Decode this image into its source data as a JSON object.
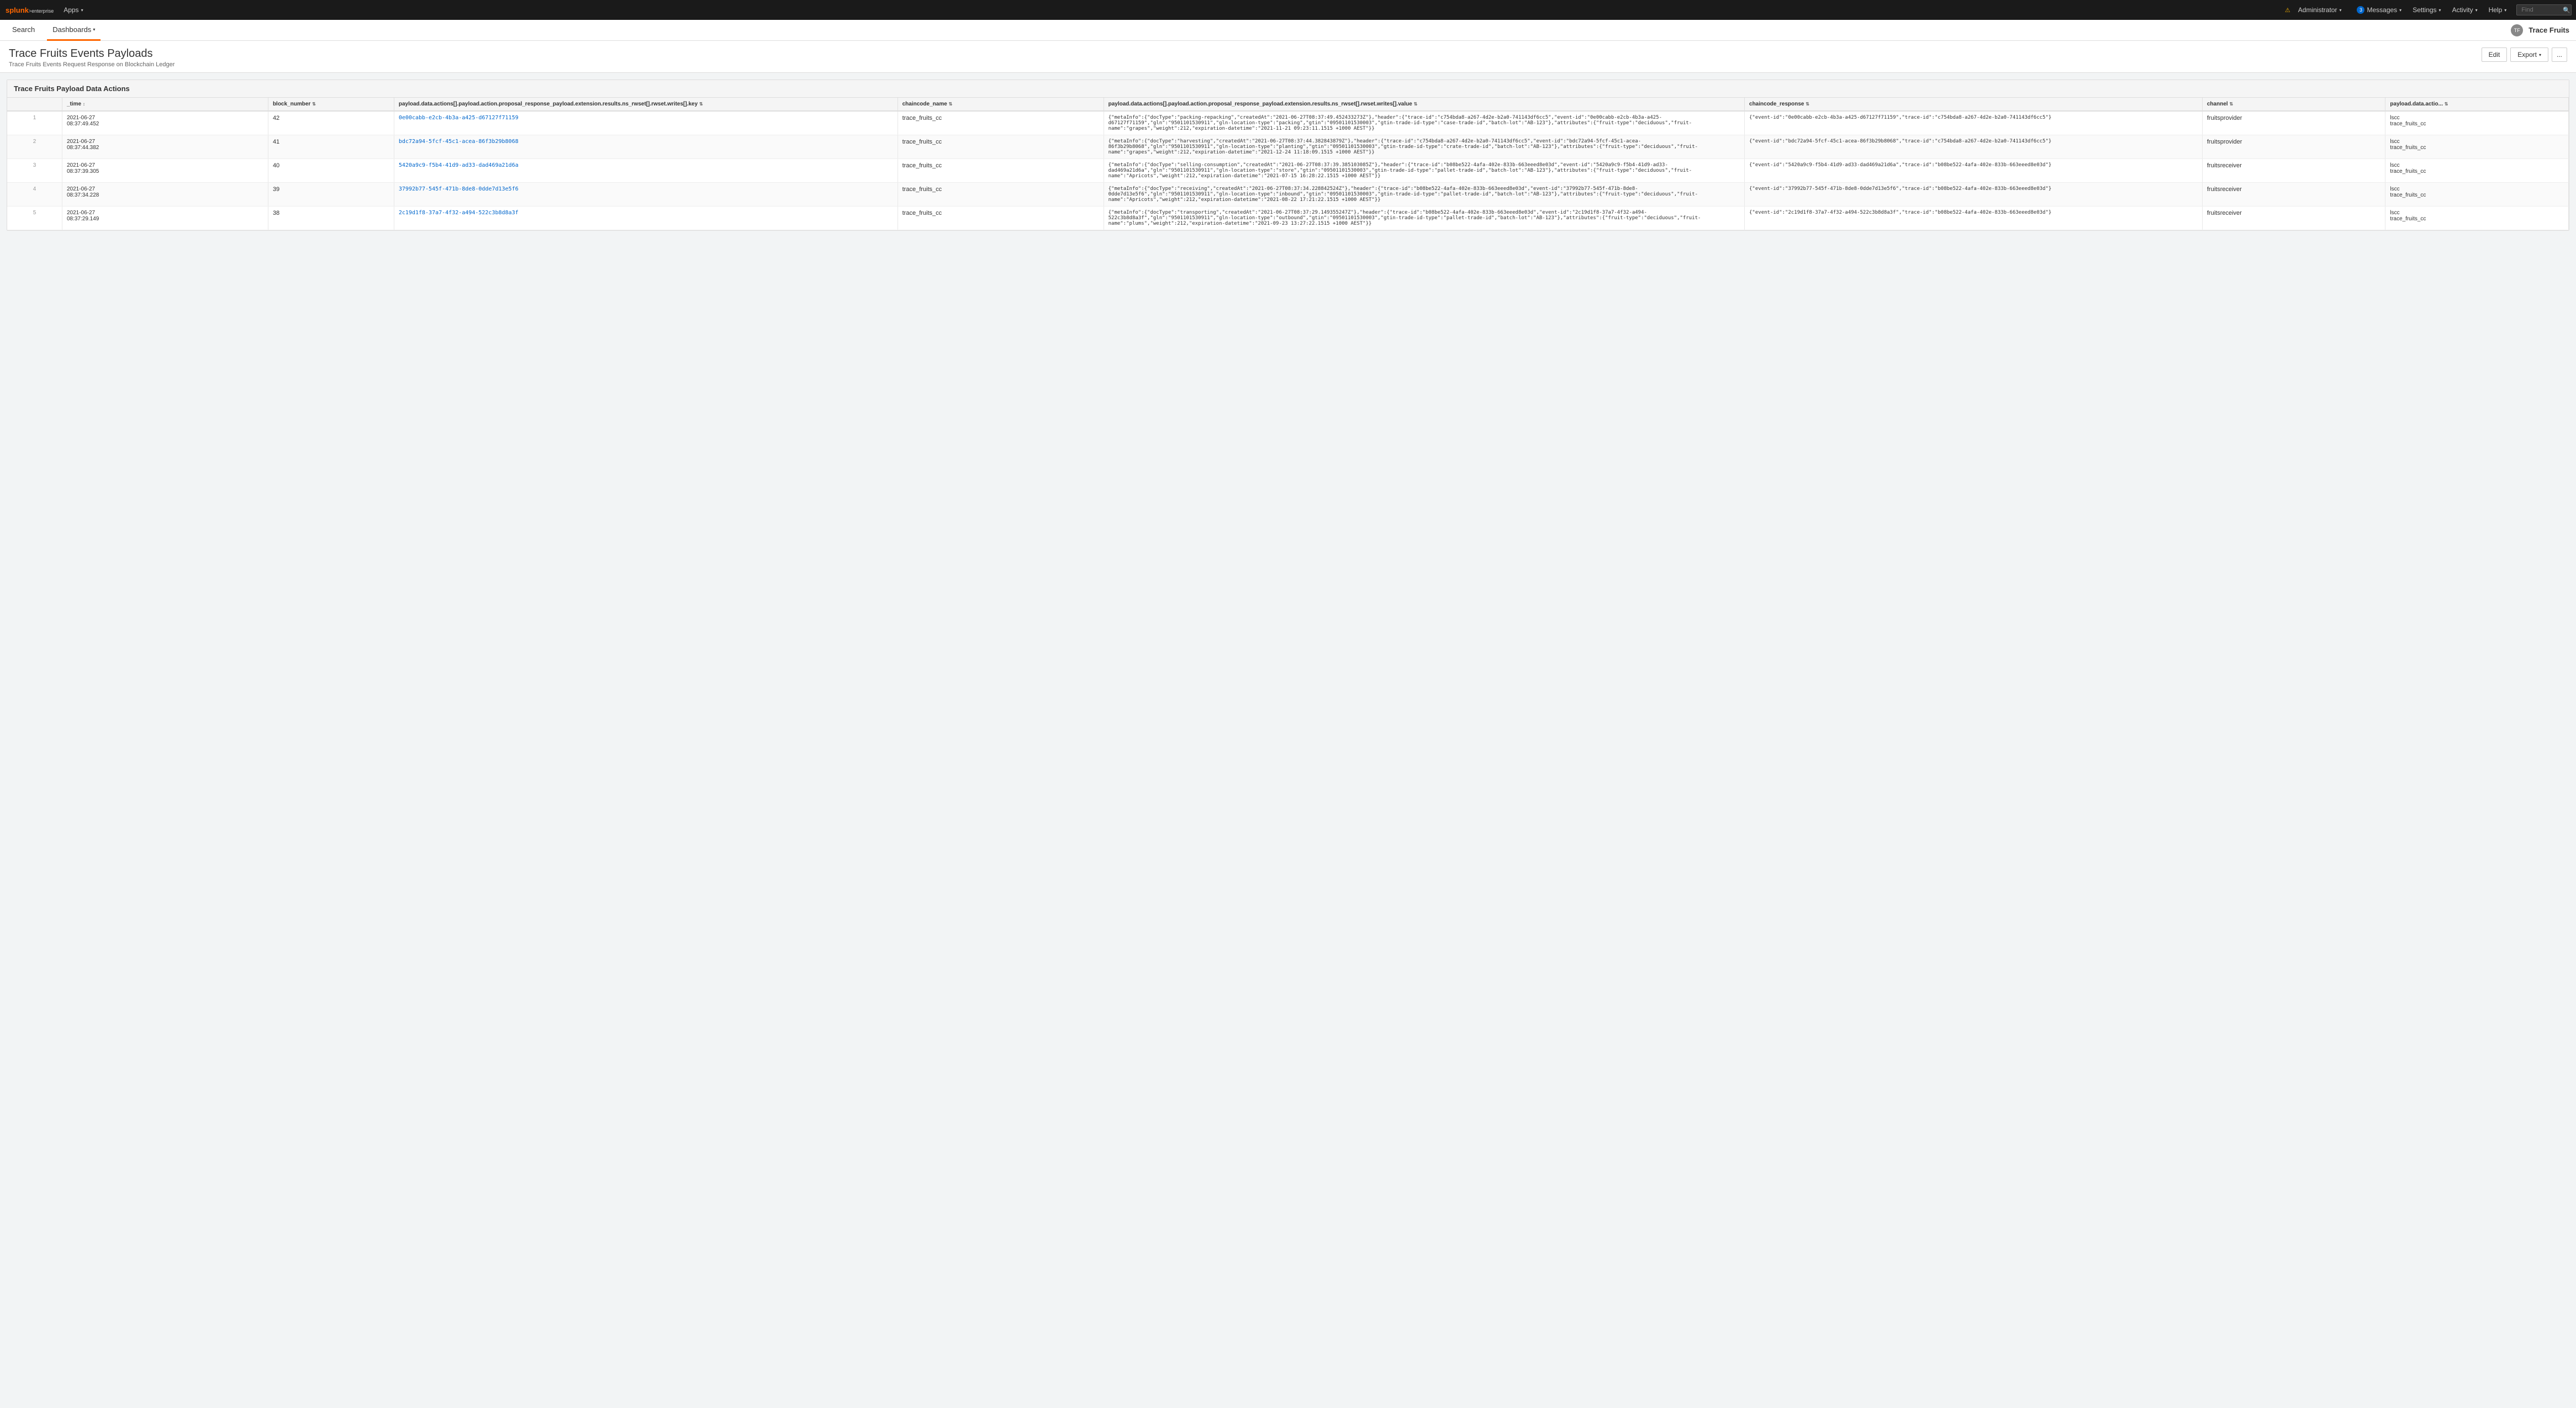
{
  "topNav": {
    "logo": "splunk>enterprise",
    "apps_label": "Apps",
    "activity_label": "Activity",
    "messages_label": "Messages",
    "messages_count": "3",
    "settings_label": "Settings",
    "help_label": "Help",
    "find_placeholder": "Find",
    "admin_label": "Administrator"
  },
  "secondNav": {
    "search_label": "Search",
    "dashboards_label": "Dashboards",
    "app_label": "Trace Fruits"
  },
  "page": {
    "title": "Trace Fruits Events Payloads",
    "subtitle": "Trace Fruits Events Request Response on Blockchain Ledger",
    "edit_label": "Edit",
    "export_label": "Export",
    "more_label": "..."
  },
  "table": {
    "title": "Trace Fruits Payload Data Actions",
    "columns": [
      "",
      "_time ↕",
      "block_number ⇅",
      "payload.data.actions[].payload.action.proposal_response_payload.extension.results.ns_rwset[].rwset.writes[].key ⇅",
      "chaincode_name ⇅",
      "payload.data.actions[].payload.action.proposal_response_payload.extension.results.ns_rwset[].rwset.writes[].value ⇅",
      "chaincode_response ⇅",
      "channel ⇅",
      "payload.data.actio... ⇅"
    ],
    "rows": [
      {
        "num": "1",
        "time": "2021-06-27\n08:37:49.452",
        "block_number": "42",
        "key": "0e00cabb-e2cb-4b3a-a425-d67127f71159",
        "chaincode_name": "trace_fruits_cc",
        "value": "{\"metaInfo\":{\"docType\":\"packing-repacking\",\"createdAt\":\"2021-06-27T08:37:49.452433273Z\"},\"header\":{\"trace-id\":\"c754bda8-a267-4d2e-b2a0-741143df6cc5\",\"event-id\":\"0e00cabb-e2cb-4b3a-a425-d67127f71159\",\"gln\":\"9501101530911\",\"gln-location-type\":\"packing\",\"gtin\":\"09501101530003\",\"gtin-trade-id-type\":\"case-trade-id\",\"batch-lot\":\"AB-123\"},\"attributes\":{\"fruit-type\":\"deciduous\",\"fruit-name\":\"grapes\",\"weight\":212,\"expiration-datetime\":\"2021-11-21 09:23:11.1515 +1000 AEST\"}}",
        "chaincode_response": "{\"event-id\":\"0e00cabb-e2cb-4b3a-a425-d67127f71159\",\"trace-id\":\"c754bda8-a267-4d2e-b2a0-741143df6cc5\"}",
        "channel": "fruitsprovider",
        "payload_action": "lscc\ntrace_fruits_cc"
      },
      {
        "num": "2",
        "time": "2021-06-27\n08:37:44.382",
        "block_number": "41",
        "key": "bdc72a94-5fcf-45c1-acea-86f3b29b8068",
        "chaincode_name": "trace_fruits_cc",
        "value": "{\"metaInfo\":{\"docType\":\"harvesting\",\"createdAt\":\"2021-06-27T08:37:44.382843879Z\"},\"header\":{\"trace-id\":\"c754bda8-a267-4d2e-b2a0-741143df6cc5\",\"event-id\":\"bdc72a94-5fcf-45c1-acea-86f3b29b8068\",\"gln\":\"9501101530911\",\"gln-location-type\":\"planting\",\"gtin\":\"09501101530003\",\"gtin-trade-id-type\":\"crate-trade-id\",\"batch-lot\":\"AB-123\"},\"attributes\":{\"fruit-type\":\"deciduous\",\"fruit-name\":\"grapes\",\"weight\":212,\"expiration-datetime\":\"2021-12-24 11:18:09.1515 +1000 AEST\"}}",
        "chaincode_response": "{\"event-id\":\"bdc72a94-5fcf-45c1-acea-86f3b29b8068\",\"trace-id\":\"c754bda8-a267-4d2e-b2a0-741143df6cc5\"}",
        "channel": "fruitsprovider",
        "payload_action": "lscc\ntrace_fruits_cc"
      },
      {
        "num": "3",
        "time": "2021-06-27\n08:37:39.305",
        "block_number": "40",
        "key": "5420a9c9-f5b4-41d9-ad33-dad469a21d6a",
        "chaincode_name": "trace_fruits_cc",
        "value": "{\"metaInfo\":{\"docType\":\"selling-consumption\",\"createdAt\":\"2021-06-27T08:37:39.385103085Z\"},\"header\":{\"trace-id\":\"b08be522-4afa-402e-833b-663eeed8e03d\",\"event-id\":\"5420a9c9-f5b4-41d9-ad33-dad469a21d6a\",\"gln\":\"9501101530911\",\"gln-location-type\":\"store\",\"gtin\":\"09501101530003\",\"gtin-trade-id-type\":\"pallet-trade-id\",\"batch-lot\":\"AB-123\"},\"attributes\":{\"fruit-type\":\"deciduous\",\"fruit-name\":\"Apricots\",\"weight\":212,\"expiration-datetime\":\"2021-07-15 16:28:22.1515 +1000 AEST\"}}",
        "chaincode_response": "{\"event-id\":\"5420a9c9-f5b4-41d9-ad33-dad469a21d6a\",\"trace-id\":\"b08be522-4afa-402e-833b-663eeed8e03d\"}",
        "channel": "fruitsreceiver",
        "payload_action": "lscc\ntrace_fruits_cc"
      },
      {
        "num": "4",
        "time": "2021-06-27\n08:37:34.228",
        "block_number": "39",
        "key": "37992b77-545f-471b-8de8-0dde7d13e5f6",
        "chaincode_name": "trace_fruits_cc",
        "value": "{\"metaInfo\":{\"docType\":\"receiving\",\"createdAt\":\"2021-06-27T08:37:34.228842524Z\"},\"header\":{\"trace-id\":\"b08be522-4afa-402e-833b-663eeed8e03d\",\"event-id\":\"37992b77-545f-471b-8de8-0dde7d13e5f6\",\"gln\":\"9501101530911\",\"gln-location-type\":\"inbound\",\"gtin\":\"09501101530003\",\"gtin-trade-id-type\":\"pallet-trade-id\",\"batch-lot\":\"AB-123\"},\"attributes\":{\"fruit-type\":\"deciduous\",\"fruit-name\":\"Apricots\",\"weight\":212,\"expiration-datetime\":\"2021-08-22 17:21:22.1515 +1000 AEST\"}}",
        "chaincode_response": "{\"event-id\":\"37992b77-545f-471b-8de8-0dde7d13e5f6\",\"trace-id\":\"b08be522-4afa-402e-833b-663eeed8e03d\"}",
        "channel": "fruitsreceiver",
        "payload_action": "lscc\ntrace_fruits_cc"
      },
      {
        "num": "5",
        "time": "2021-06-27\n08:37:29.149",
        "block_number": "38",
        "key": "2c19d1f8-37a7-4f32-a494-522c3b8d8a3f",
        "chaincode_name": "trace_fruits_cc",
        "value": "{\"metaInfo\":{\"docType\":\"transporting\",\"createdAt\":\"2021-06-27T08:37:29.149355247Z\"},\"header\":{\"trace-id\":\"b08be522-4afa-402e-833b-663eeed8e03d\",\"event-id\":\"2c19d1f8-37a7-4f32-a494-522c3b8d8a3f\",\"gln\":\"9501101530911\",\"gln-location-type\":\"outbound\",\"gtin\":\"09501101530003\",\"gtin-trade-id-type\":\"pallet-trade-id\",\"batch-lot\":\"AB-123\"},\"attributes\":{\"fruit-type\":\"deciduous\",\"fruit-name\":\"plums\",\"weight\":212,\"expiration-datetime\":\"2021-09-23 13:27:22.1515 +1000 AEST\"}}",
        "chaincode_response": "{\"event-id\":\"2c19d1f8-37a7-4f32-a494-522c3b8d8a3f\",\"trace-id\":\"b08be522-4afa-402e-833b-663eeed8e03d\"}",
        "channel": "fruitsreceiver",
        "payload_action": "lscc\ntrace_fruits_cc"
      }
    ]
  }
}
